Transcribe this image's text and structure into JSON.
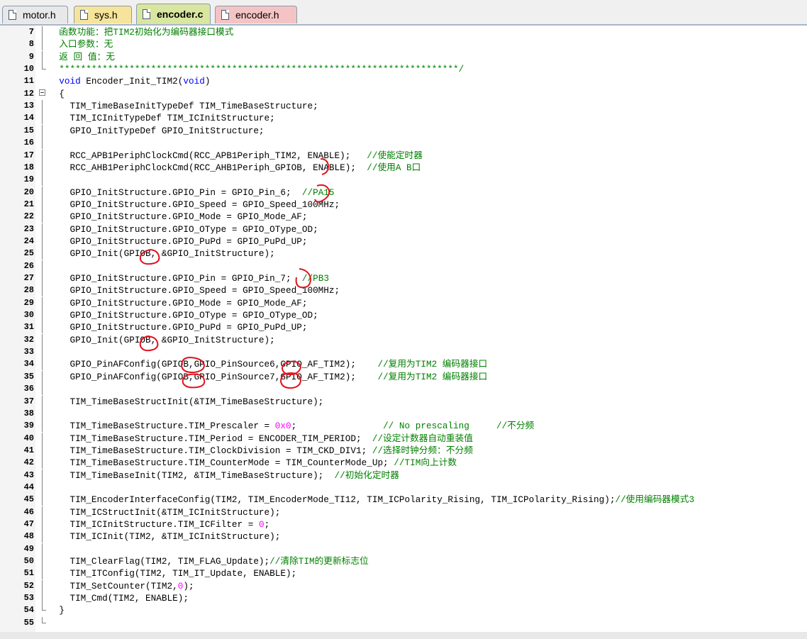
{
  "tabs": [
    {
      "label": "motor.h",
      "color": "#e8e8e8",
      "active": false
    },
    {
      "label": "sys.h",
      "color": "#f6e49a",
      "active": false
    },
    {
      "label": "encoder.c",
      "color": "#d8e6a0",
      "active": true
    },
    {
      "label": "encoder.h",
      "color": "#f4c4c4",
      "active": false
    }
  ],
  "lines": [
    {
      "n": "7",
      "fold": "bar",
      "parts": [
        {
          "t": "  函数功能：把TIM2初始化为编码器接口模式",
          "c": "cm"
        }
      ]
    },
    {
      "n": "8",
      "fold": "bar",
      "parts": [
        {
          "t": "  入口参数：无",
          "c": "cm"
        }
      ]
    },
    {
      "n": "9",
      "fold": "bar",
      "parts": [
        {
          "t": "  返 回 值：无",
          "c": "cm"
        }
      ]
    },
    {
      "n": "10",
      "fold": "end",
      "parts": [
        {
          "t": "  **************************************************************************/",
          "c": "cm"
        }
      ]
    },
    {
      "n": "11",
      "fold": "",
      "parts": [
        {
          "t": "  void",
          "c": "kw"
        },
        {
          "t": " Encoder_Init_TIM2(",
          "c": ""
        },
        {
          "t": "void",
          "c": "kw"
        },
        {
          "t": ")",
          "c": ""
        }
      ]
    },
    {
      "n": "12",
      "fold": "box",
      "parts": [
        {
          "t": "  {",
          "c": ""
        }
      ]
    },
    {
      "n": "13",
      "fold": "bar",
      "parts": [
        {
          "t": "    TIM_TimeBaseInitTypeDef TIM_TimeBaseStructure;",
          "c": ""
        }
      ]
    },
    {
      "n": "14",
      "fold": "bar",
      "parts": [
        {
          "t": "    TIM_ICInitTypeDef TIM_ICInitStructure;",
          "c": ""
        }
      ]
    },
    {
      "n": "15",
      "fold": "bar",
      "parts": [
        {
          "t": "    GPIO_InitTypeDef GPIO_InitStructure;",
          "c": ""
        }
      ]
    },
    {
      "n": "16",
      "fold": "bar",
      "parts": [
        {
          "t": "",
          "c": ""
        }
      ]
    },
    {
      "n": "17",
      "fold": "bar",
      "parts": [
        {
          "t": "    RCC_APB1PeriphClockCmd(RCC_APB1Periph_TIM2, ENABLE);   ",
          "c": ""
        },
        {
          "t": "//使能定时器",
          "c": "cm"
        }
      ]
    },
    {
      "n": "18",
      "fold": "bar",
      "parts": [
        {
          "t": "    RCC_AHB1PeriphClockCmd(RCC_AHB1Periph_GPIOB, ENABLE);  ",
          "c": ""
        },
        {
          "t": "//使用A B口",
          "c": "cm"
        }
      ]
    },
    {
      "n": "19",
      "fold": "bar",
      "parts": [
        {
          "t": "",
          "c": ""
        }
      ]
    },
    {
      "n": "20",
      "fold": "bar",
      "parts": [
        {
          "t": "    GPIO_InitStructure.GPIO_Pin = GPIO_Pin_6;  ",
          "c": ""
        },
        {
          "t": "//PA15",
          "c": "cm"
        }
      ]
    },
    {
      "n": "21",
      "fold": "bar",
      "parts": [
        {
          "t": "    GPIO_InitStructure.GPIO_Speed = GPIO_Speed_100MHz;",
          "c": ""
        }
      ]
    },
    {
      "n": "22",
      "fold": "bar",
      "parts": [
        {
          "t": "    GPIO_InitStructure.GPIO_Mode = GPIO_Mode_AF;",
          "c": ""
        }
      ]
    },
    {
      "n": "23",
      "fold": "bar",
      "parts": [
        {
          "t": "    GPIO_InitStructure.GPIO_OType = GPIO_OType_OD;",
          "c": ""
        }
      ]
    },
    {
      "n": "24",
      "fold": "bar",
      "parts": [
        {
          "t": "    GPIO_InitStructure.GPIO_PuPd = GPIO_PuPd_UP;",
          "c": ""
        }
      ]
    },
    {
      "n": "25",
      "fold": "bar",
      "parts": [
        {
          "t": "    GPIO_Init(GPIOB, &GPIO_InitStructure);",
          "c": ""
        }
      ]
    },
    {
      "n": "26",
      "fold": "bar",
      "parts": [
        {
          "t": "",
          "c": ""
        }
      ]
    },
    {
      "n": "27",
      "fold": "bar",
      "parts": [
        {
          "t": "    GPIO_InitStructure.GPIO_Pin = GPIO_Pin_7;  ",
          "c": ""
        },
        {
          "t": "//PB3",
          "c": "cm"
        }
      ]
    },
    {
      "n": "28",
      "fold": "bar",
      "parts": [
        {
          "t": "    GPIO_InitStructure.GPIO_Speed = GPIO_Speed_100MHz;",
          "c": ""
        }
      ]
    },
    {
      "n": "29",
      "fold": "bar",
      "parts": [
        {
          "t": "    GPIO_InitStructure.GPIO_Mode = GPIO_Mode_AF;",
          "c": ""
        }
      ]
    },
    {
      "n": "30",
      "fold": "bar",
      "parts": [
        {
          "t": "    GPIO_InitStructure.GPIO_OType = GPIO_OType_OD;",
          "c": ""
        }
      ]
    },
    {
      "n": "31",
      "fold": "bar",
      "parts": [
        {
          "t": "    GPIO_InitStructure.GPIO_PuPd = GPIO_PuPd_UP;",
          "c": ""
        }
      ]
    },
    {
      "n": "32",
      "fold": "bar",
      "parts": [
        {
          "t": "    GPIO_Init(GPIOB, &GPIO_InitStructure);",
          "c": ""
        }
      ]
    },
    {
      "n": "33",
      "fold": "bar",
      "parts": [
        {
          "t": "",
          "c": ""
        }
      ]
    },
    {
      "n": "34",
      "fold": "bar",
      "parts": [
        {
          "t": "    GPIO_PinAFConfig(GPIOB,GPIO_PinSource6,GPIO_AF_TIM2);    ",
          "c": ""
        },
        {
          "t": "//复用为TIM2 编码器接口",
          "c": "cm"
        }
      ]
    },
    {
      "n": "35",
      "fold": "bar",
      "parts": [
        {
          "t": "    GPIO_PinAFConfig(GPIOB,GPIO_PinSource7,GPIO_AF_TIM2);    ",
          "c": ""
        },
        {
          "t": "//复用为TIM2 编码器接口",
          "c": "cm"
        }
      ]
    },
    {
      "n": "36",
      "fold": "bar",
      "parts": [
        {
          "t": "",
          "c": ""
        }
      ]
    },
    {
      "n": "37",
      "fold": "bar",
      "parts": [
        {
          "t": "    TIM_TimeBaseStructInit(&TIM_TimeBaseStructure);",
          "c": ""
        }
      ]
    },
    {
      "n": "38",
      "fold": "bar",
      "parts": [
        {
          "t": "",
          "c": ""
        }
      ]
    },
    {
      "n": "39",
      "fold": "bar",
      "parts": [
        {
          "t": "    TIM_TimeBaseStructure.TIM_Prescaler = ",
          "c": ""
        },
        {
          "t": "0x0",
          "c": "nm"
        },
        {
          "t": ";                ",
          "c": ""
        },
        {
          "t": "// No prescaling     //不分频",
          "c": "cm"
        }
      ]
    },
    {
      "n": "40",
      "fold": "bar",
      "parts": [
        {
          "t": "    TIM_TimeBaseStructure.TIM_Period = ENCODER_TIM_PERIOD;  ",
          "c": ""
        },
        {
          "t": "//设定计数器自动重装值",
          "c": "cm"
        }
      ]
    },
    {
      "n": "41",
      "fold": "bar",
      "parts": [
        {
          "t": "    TIM_TimeBaseStructure.TIM_ClockDivision = TIM_CKD_DIV1; ",
          "c": ""
        },
        {
          "t": "//选择时钟分频：不分频",
          "c": "cm"
        }
      ]
    },
    {
      "n": "42",
      "fold": "bar",
      "parts": [
        {
          "t": "    TIM_TimeBaseStructure.TIM_CounterMode = TIM_CounterMode_Up; ",
          "c": ""
        },
        {
          "t": "//TIM向上计数",
          "c": "cm"
        }
      ]
    },
    {
      "n": "43",
      "fold": "bar",
      "parts": [
        {
          "t": "    TIM_TimeBaseInit(TIM2, &TIM_TimeBaseStructure);  ",
          "c": ""
        },
        {
          "t": "//初始化定时器",
          "c": "cm"
        }
      ]
    },
    {
      "n": "44",
      "fold": "bar",
      "parts": [
        {
          "t": "",
          "c": ""
        }
      ]
    },
    {
      "n": "45",
      "fold": "bar",
      "parts": [
        {
          "t": "    TIM_EncoderInterfaceConfig(TIM2, TIM_EncoderMode_TI12, TIM_ICPolarity_Rising, TIM_ICPolarity_Rising);",
          "c": ""
        },
        {
          "t": "//使用编码器模式3",
          "c": "cm"
        }
      ]
    },
    {
      "n": "46",
      "fold": "bar",
      "parts": [
        {
          "t": "    TIM_ICStructInit(&TIM_ICInitStructure);",
          "c": ""
        }
      ]
    },
    {
      "n": "47",
      "fold": "bar",
      "parts": [
        {
          "t": "    TIM_ICInitStructure.TIM_ICFilter = ",
          "c": ""
        },
        {
          "t": "0",
          "c": "nm"
        },
        {
          "t": ";",
          "c": ""
        }
      ]
    },
    {
      "n": "48",
      "fold": "bar",
      "parts": [
        {
          "t": "    TIM_ICInit(TIM2, &TIM_ICInitStructure);",
          "c": ""
        }
      ]
    },
    {
      "n": "49",
      "fold": "bar",
      "parts": [
        {
          "t": "",
          "c": ""
        }
      ]
    },
    {
      "n": "50",
      "fold": "bar",
      "parts": [
        {
          "t": "    TIM_ClearFlag(TIM2, TIM_FLAG_Update);",
          "c": ""
        },
        {
          "t": "//清除TIM的更新标志位",
          "c": "cm"
        }
      ]
    },
    {
      "n": "51",
      "fold": "bar",
      "parts": [
        {
          "t": "    TIM_ITConfig(TIM2, TIM_IT_Update, ENABLE);",
          "c": ""
        }
      ]
    },
    {
      "n": "52",
      "fold": "bar",
      "parts": [
        {
          "t": "    TIM_SetCounter(TIM2,",
          "c": ""
        },
        {
          "t": "0",
          "c": "nm"
        },
        {
          "t": ");",
          "c": ""
        }
      ]
    },
    {
      "n": "53",
      "fold": "bar",
      "parts": [
        {
          "t": "    TIM_Cmd(TIM2, ENABLE);",
          "c": ""
        }
      ]
    },
    {
      "n": "54",
      "fold": "end",
      "parts": [
        {
          "t": "  }",
          "c": ""
        }
      ]
    },
    {
      "n": "55",
      "fold": "end",
      "parts": [
        {
          "t": "",
          "c": ""
        }
      ]
    }
  ],
  "annotation_color": "#e0141e"
}
